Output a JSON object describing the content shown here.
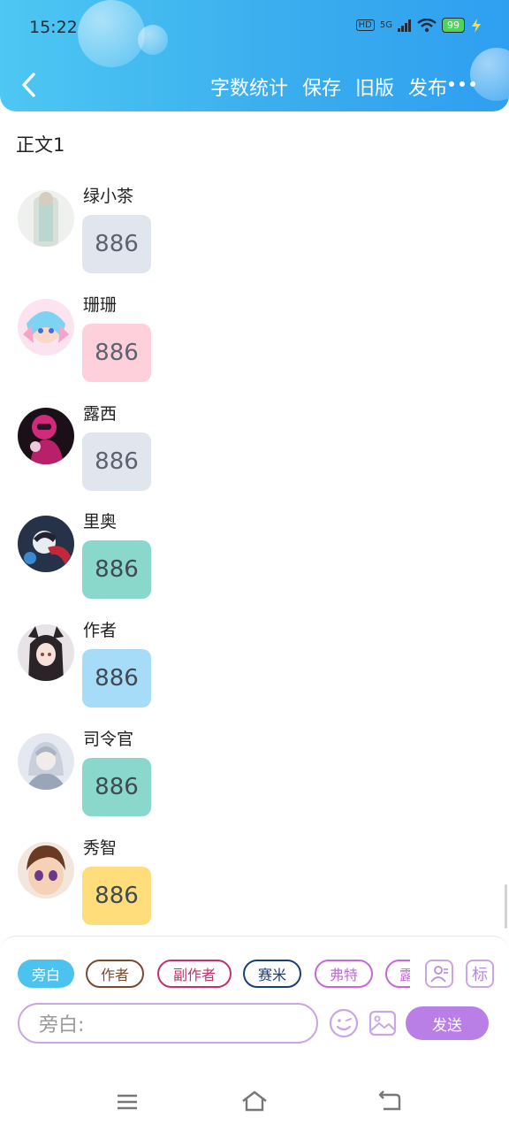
{
  "status_bar": {
    "time": "15:22",
    "network_hd": "HD",
    "network_5g": "5G",
    "battery": "99",
    "icons": [
      "signal-icon",
      "wifi-icon",
      "battery-icon",
      "charging-icon"
    ]
  },
  "header": {
    "actions": [
      "字数统计",
      "保存",
      "旧版",
      "发布"
    ],
    "back_icon": "chevron-left-icon",
    "more_icon": "more-horizontal-icon",
    "accent": "#3aaeee"
  },
  "section_title": "正文1",
  "messages": [
    {
      "name": "绿小茶",
      "text": "886",
      "bubble_color": "#e1e6ee",
      "text_color": "#5b6370"
    },
    {
      "name": "珊珊",
      "text": "886",
      "bubble_color": "#fdd0dc",
      "text_color": "#5b6370"
    },
    {
      "name": "露西",
      "text": "886",
      "bubble_color": "#e1e6ee",
      "text_color": "#5b6370"
    },
    {
      "name": "里奥",
      "text": "886",
      "bubble_color": "#8ad8cc",
      "text_color": "#3f4a52"
    },
    {
      "name": "作者",
      "text": "886",
      "bubble_color": "#a6dcf8",
      "text_color": "#3f4a52"
    },
    {
      "name": "司令官",
      "text": "886",
      "bubble_color": "#8ad8cc",
      "text_color": "#3f4a52"
    },
    {
      "name": "秀智",
      "text": "886",
      "bubble_color": "#fedd7a",
      "text_color": "#3f4a52"
    }
  ],
  "composer": {
    "roles": [
      {
        "label": "旁白",
        "active": true,
        "color": "#4cc3ef"
      },
      {
        "label": "作者",
        "active": false,
        "color": "#7a4a2e"
      },
      {
        "label": "副作者",
        "active": false,
        "color": "#c2306e"
      },
      {
        "label": "赛米",
        "active": false,
        "color": "#1b3d7a"
      },
      {
        "label": "弗特",
        "active": false,
        "color": "#c26ad6"
      },
      {
        "label": "露",
        "active": false,
        "color": "#c26ad6"
      }
    ],
    "role_manage_icon": "person-list-icon",
    "tag_label": "标",
    "input_placeholder": "旁白:",
    "emoji_icon": "smiley-icon",
    "image_icon": "image-icon",
    "send_label": "发送",
    "accent": "#b97fe6"
  },
  "nav_bar": {
    "icons": [
      "menu-icon",
      "home-icon",
      "back-icon"
    ]
  }
}
